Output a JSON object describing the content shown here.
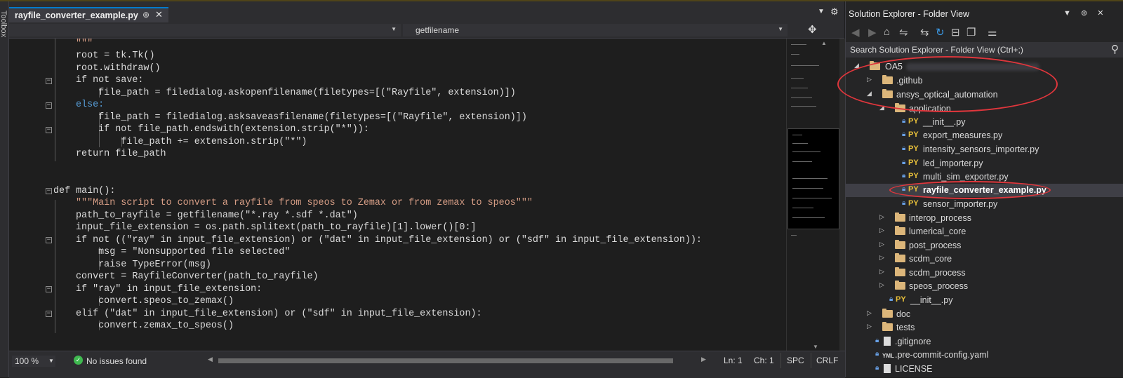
{
  "editor": {
    "tab_title": "rayfile_converter_example.py",
    "pin_glyph": "⊕",
    "close_glyph": "✕",
    "nav_right": "getfilename",
    "zoom": "100 %",
    "issues": "No issues found",
    "ln": "Ln: 1",
    "ch": "Ch: 1",
    "spc": "SPC",
    "crlf": "CRLF"
  },
  "toolbox_label": "Toolbox",
  "code_lines": [
    "\"\"\"",
    "root = tk.Tk()",
    "root.withdraw()",
    "if not save:",
    "    file_path = filedialog.askopenfilename(filetypes=[(\"Rayfile\", extension)])",
    "else:",
    "    file_path = filedialog.asksaveasfilename(filetypes=[(\"Rayfile\", extension)])",
    "    if not file_path.endswith(extension.strip(\"*\")):",
    "        file_path += extension.strip(\"*\")",
    "return file_path",
    "",
    "",
    "def main():",
    "\"\"\"Main script to convert a rayfile from speos to Zemax or from zemax to speos\"\"\"",
    "path_to_rayfile = getfilename(\"*.ray *.sdf *.dat\")",
    "input_file_extension = os.path.splitext(path_to_rayfile)[1].lower()[0:]",
    "if not ((\"ray\" in input_file_extension) or (\"dat\" in input_file_extension) or (\"sdf\" in input_file_extension)):",
    "    msg = \"Nonsupported file selected\"",
    "    raise TypeError(msg)",
    "convert = RayfileConverter(path_to_rayfile)",
    "if \"ray\" in input_file_extension:",
    "    convert.speos_to_zemax()",
    "elif (\"dat\" in input_file_extension) or (\"sdf\" in input_file_extension):",
    "    convert.zemax_to_speos()"
  ],
  "solution_explorer": {
    "title": "Solution Explorer - Folder View",
    "search_placeholder": "Search Solution Explorer - Folder View (Ctrl+;)",
    "items": [
      {
        "label": "OA5",
        "kind": "folder",
        "expander": "◢"
      },
      {
        "label": ".github",
        "kind": "folder",
        "expander": "▷"
      },
      {
        "label": "ansys_optical_automation",
        "kind": "folder",
        "expander": "◢"
      },
      {
        "label": "application",
        "kind": "folder",
        "expander": "◢"
      },
      {
        "label": "__init__.py",
        "kind": "py"
      },
      {
        "label": "export_measures.py",
        "kind": "py"
      },
      {
        "label": "intensity_sensors_importer.py",
        "kind": "py"
      },
      {
        "label": "led_importer.py",
        "kind": "py"
      },
      {
        "label": "multi_sim_exporter.py",
        "kind": "py"
      },
      {
        "label": "rayfile_converter_example.py",
        "kind": "py",
        "selected": true
      },
      {
        "label": "sensor_importer.py",
        "kind": "py"
      },
      {
        "label": "interop_process",
        "kind": "folder",
        "expander": "▷"
      },
      {
        "label": "lumerical_core",
        "kind": "folder",
        "expander": "▷"
      },
      {
        "label": "post_process",
        "kind": "folder",
        "expander": "▷"
      },
      {
        "label": "scdm_core",
        "kind": "folder",
        "expander": "▷"
      },
      {
        "label": "scdm_process",
        "kind": "folder",
        "expander": "▷"
      },
      {
        "label": "speos_process",
        "kind": "folder",
        "expander": "▷"
      },
      {
        "label": "__init__.py",
        "kind": "py"
      },
      {
        "label": "doc",
        "kind": "folder",
        "expander": "▷"
      },
      {
        "label": "tests",
        "kind": "folder",
        "expander": "▷"
      },
      {
        "label": ".gitignore",
        "kind": "file"
      },
      {
        "label": ".pre-commit-config.yaml",
        "kind": "yaml"
      },
      {
        "label": "LICENSE",
        "kind": "file"
      }
    ],
    "py_badge": "PY",
    "yaml_badge": "YML"
  },
  "colors": {
    "keyword": "#569cd6",
    "function": "#dcdcaa",
    "string": "#d69d85",
    "class": "#4ec9b0",
    "annotation_circle": "#e0363c",
    "folder": "#dcb67a"
  }
}
